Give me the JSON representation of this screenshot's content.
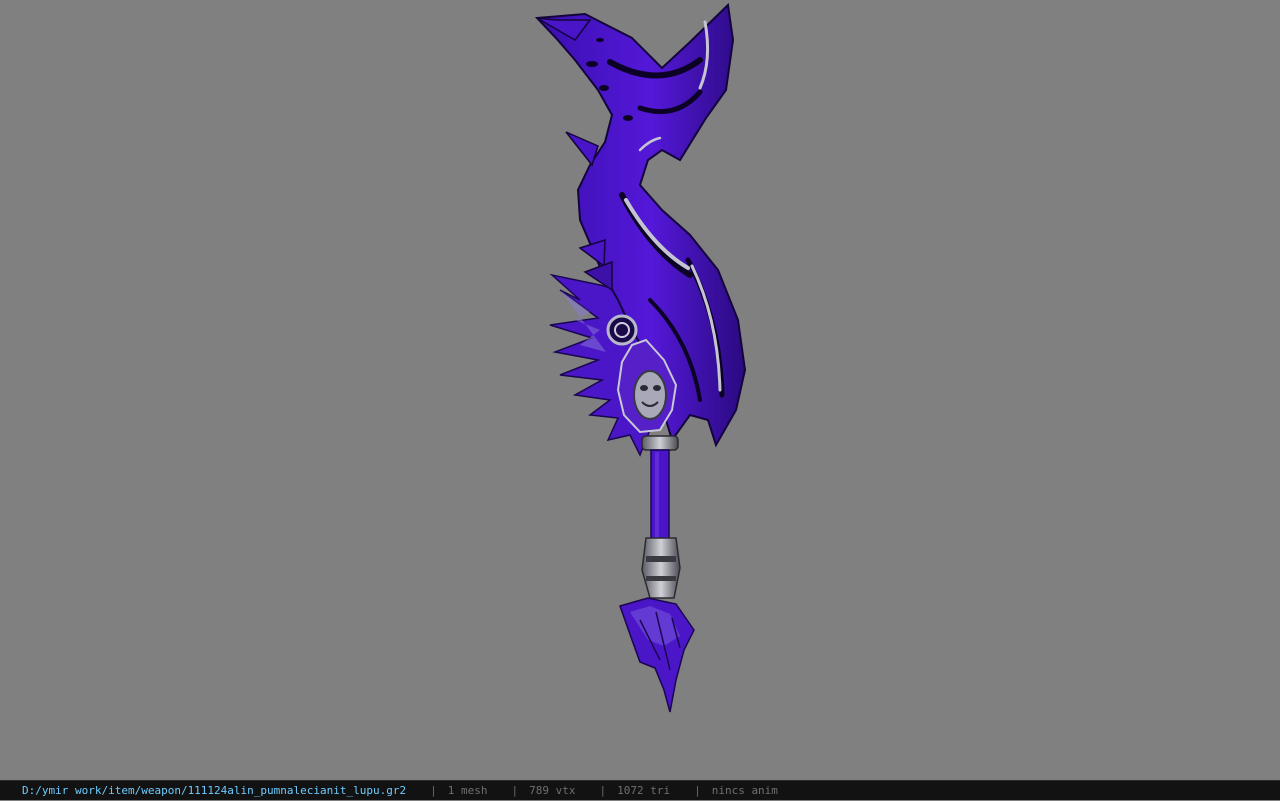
{
  "viewport": {
    "background": "#808080",
    "model_name": "weapon-model",
    "model_colors": {
      "blade": "#4a14c8",
      "blade_dark": "#1c0660",
      "trim": "#b8b8c8",
      "metal": "#9a9aa4"
    }
  },
  "statusbar": {
    "file_path": "D:/ymir work/item/weapon/111124alin_pumnalecianit_lupu.gr2",
    "separator": "|",
    "mesh_count": "1 mesh",
    "vertex_count": "789 vtx",
    "triangle_count": "1072 tri",
    "animation": "nincs anim",
    "colors": {
      "path": "#6ecbff",
      "stats": "#6f6f6f",
      "background": "#121212"
    }
  }
}
